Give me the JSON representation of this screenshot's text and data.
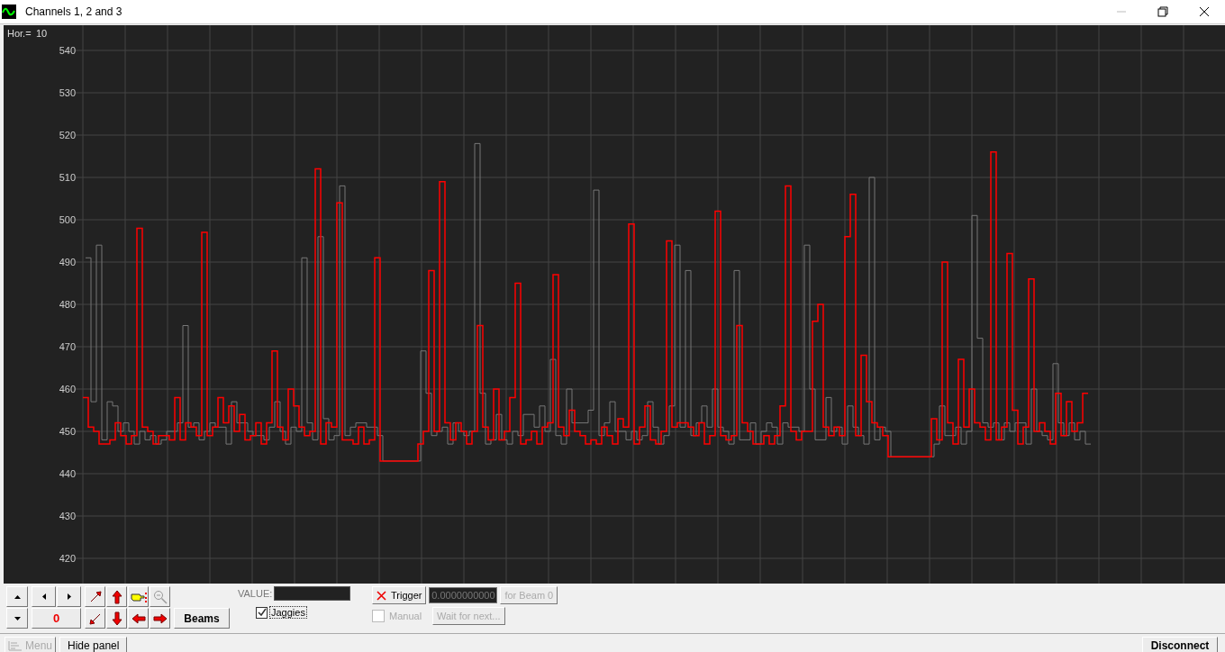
{
  "window": {
    "title": "Channels 1, 2 and 3"
  },
  "scope": {
    "scale_label": "Hor.=",
    "scale_value": "10",
    "y_labels": [
      "540",
      "530",
      "520",
      "510",
      "500",
      "490",
      "480",
      "470",
      "460",
      "450",
      "440",
      "430",
      "420"
    ]
  },
  "panel": {
    "counter": "0",
    "beams_button": "Beams",
    "value_label": "VALUE:",
    "jaggies": {
      "label": "Jaggies",
      "checked": true
    },
    "trigger_button": "Trigger",
    "trigger_value": "0.0000000000",
    "beam_button": {
      "label": "for Beam 0",
      "disabled": true
    },
    "manual": {
      "label": "Manual",
      "checked": false,
      "disabled": true
    },
    "wait_button": {
      "label": "Wait for next...",
      "disabled": true
    }
  },
  "bottom_bar": {
    "menu_button": {
      "label": "Menu",
      "disabled": true
    },
    "hide_button": "Hide panel",
    "disconnect_button": "Disconnect"
  }
}
